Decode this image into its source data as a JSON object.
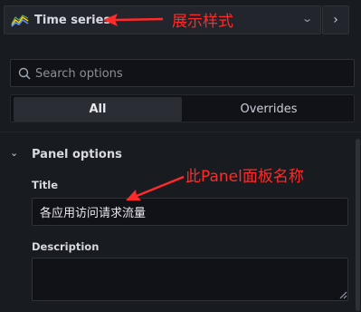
{
  "viz": {
    "name": "Time series",
    "icon": "timeseries-chart-icon",
    "chevron": "chevron-down-icon",
    "nav_icon": "chevron-right-icon"
  },
  "search": {
    "placeholder": "Search options",
    "icon": "search-icon"
  },
  "tabs": [
    {
      "label": "All",
      "active": true
    },
    {
      "label": "Overrides",
      "active": false
    }
  ],
  "section": {
    "title": "Panel options",
    "expanded": true
  },
  "fields": {
    "title": {
      "label": "Title",
      "value": "各应用访问请求流量"
    },
    "description": {
      "label": "Description",
      "value": ""
    }
  },
  "annotations": {
    "viz_note": "展示样式",
    "title_note": "此Panel面板名称",
    "color": "#ff2a2a"
  },
  "colors": {
    "background": "#181b1f",
    "input_bg": "#111217",
    "border": "#2f3237",
    "text": "#ccccdc"
  }
}
